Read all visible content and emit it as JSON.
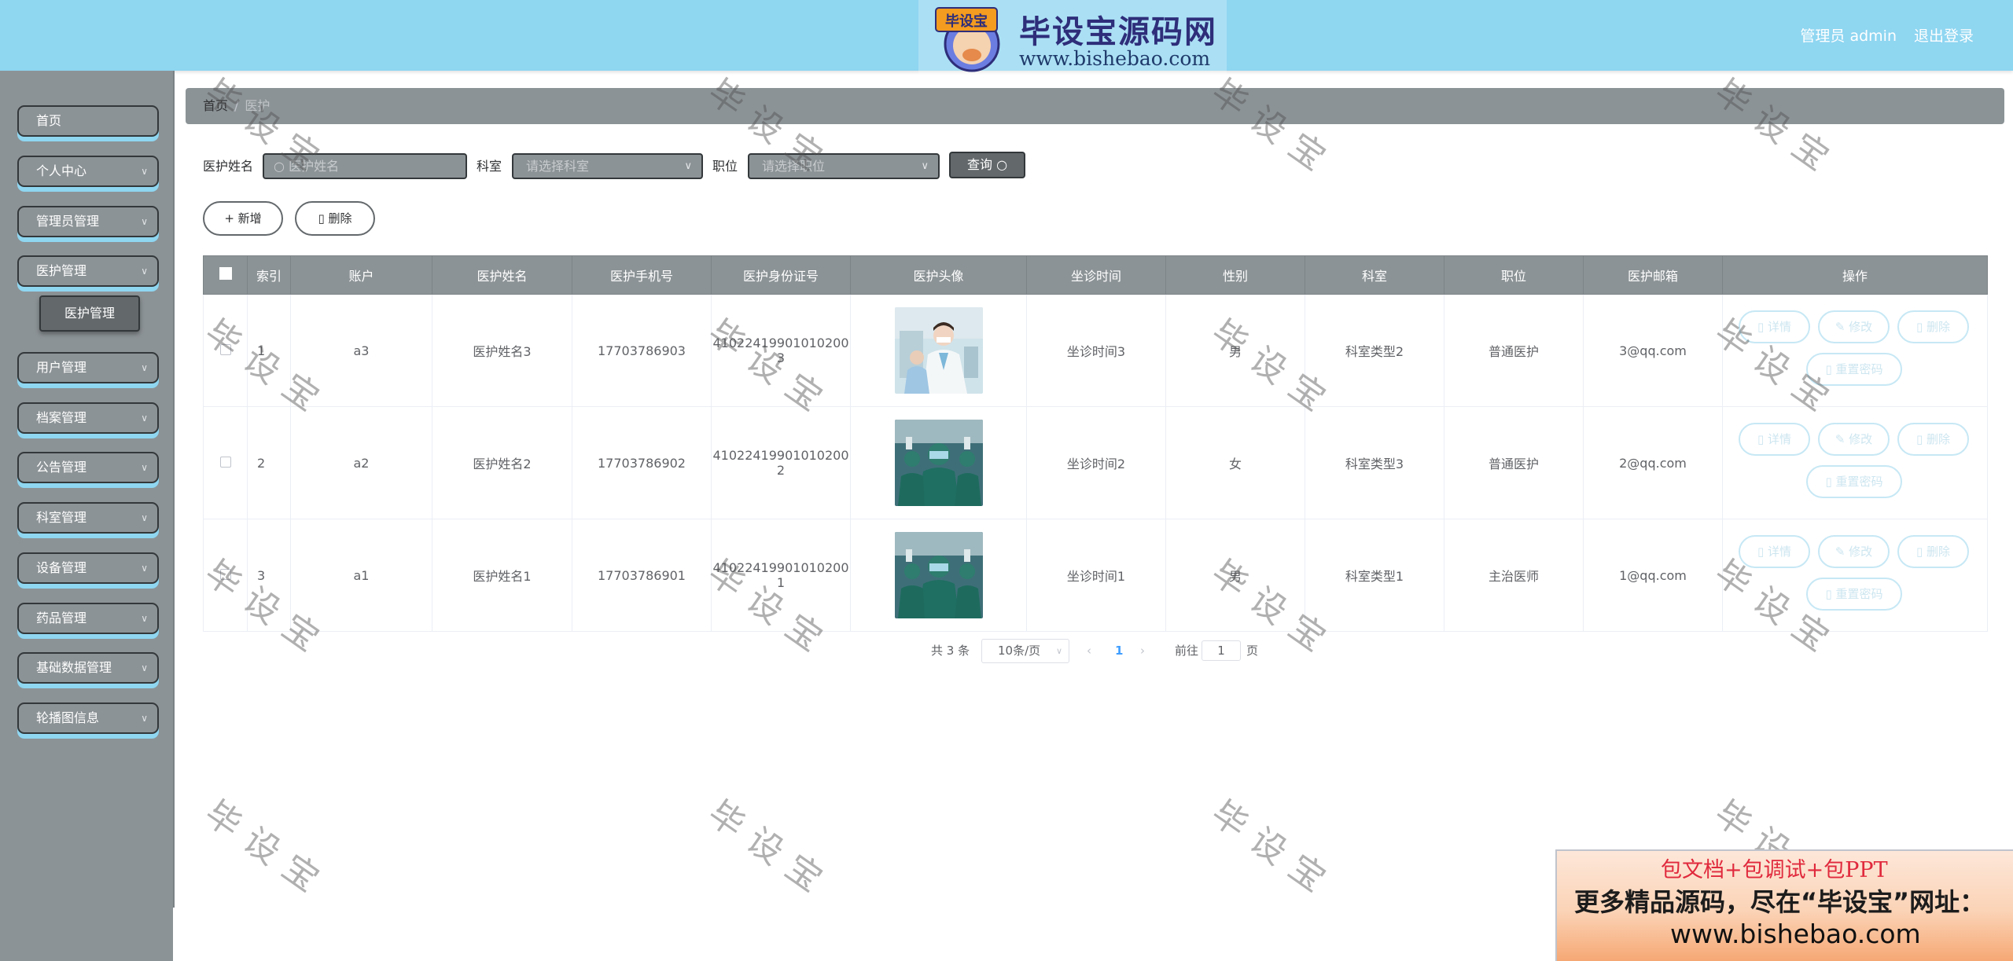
{
  "header": {
    "logo_title": "毕设宝源码网",
    "logo_url": "www.bishebao.com",
    "logo_badge": "毕设宝",
    "user": "管理员 admin",
    "logout": "退出登录"
  },
  "sidebar": {
    "items": [
      {
        "label": "首页"
      },
      {
        "label": "个人中心",
        "arrow": "∨"
      },
      {
        "label": "管理员管理",
        "arrow": "∨"
      },
      {
        "label": "医护管理",
        "arrow": "∨"
      },
      {
        "label": "用户管理",
        "arrow": "∨"
      },
      {
        "label": "档案管理",
        "arrow": "∨"
      },
      {
        "label": "公告管理",
        "arrow": "∨"
      },
      {
        "label": "科室管理",
        "arrow": "∨"
      },
      {
        "label": "设备管理",
        "arrow": "∨"
      },
      {
        "label": "药品管理",
        "arrow": "∨"
      },
      {
        "label": "基础数据管理",
        "arrow": "∨"
      },
      {
        "label": "轮播图信息",
        "arrow": "∨"
      }
    ],
    "sub_item": "医护管理"
  },
  "breadcrumb": {
    "home": "首页",
    "separator": "/",
    "current": "医护"
  },
  "search": {
    "name_label": "医护姓名",
    "name_placeholder": "医护姓名",
    "dept_label": "科室",
    "dept_placeholder": "请选择科室",
    "post_label": "职位",
    "post_placeholder": "请选择职位",
    "query_label": "查询"
  },
  "actions": {
    "add_label": "新增",
    "delete_label": "删除"
  },
  "table": {
    "columns": [
      "索引",
      "账户",
      "医护姓名",
      "医护手机号",
      "医护身份证号",
      "医护头像",
      "坐诊时间",
      "性别",
      "科室",
      "职位",
      "医护邮箱",
      "操作"
    ],
    "rows": [
      {
        "index": "1",
        "account": "a3",
        "name": "医护姓名3",
        "phone": "17703786903",
        "id_card": "410224199010102003",
        "time": "坐诊时间3",
        "gender": "男",
        "dept": "科室类型2",
        "post": "普通医护",
        "email": "3@qq.com"
      },
      {
        "index": "2",
        "account": "a2",
        "name": "医护姓名2",
        "phone": "17703786902",
        "id_card": "410224199010102002",
        "time": "坐诊时间2",
        "gender": "女",
        "dept": "科室类型3",
        "post": "普通医护",
        "email": "2@qq.com"
      },
      {
        "index": "3",
        "account": "a1",
        "name": "医护姓名1",
        "phone": "17703786901",
        "id_card": "410224199010102001",
        "time": "坐诊时间1",
        "gender": "男",
        "dept": "科室类型1",
        "post": "主治医师",
        "email": "1@qq.com"
      }
    ],
    "ops": {
      "detail": "详情",
      "edit": "修改",
      "delete": "删除",
      "reset": "重置密码"
    }
  },
  "pagination": {
    "total": "共 3 条",
    "page_size": "10条/页",
    "prev": "‹",
    "current_page": "1",
    "next": "›",
    "goto_label": "前往",
    "goto_value": "1",
    "page_unit": "页"
  },
  "watermark": "毕设宝",
  "ad": {
    "line1": "包文档+包调试+包PPT",
    "line2": "更多精品源码，尽在“毕设宝”网址：",
    "line3": "www.bishebao.com"
  },
  "colors": {
    "header_bg": "#8fd6f1",
    "sidebar_bg": "#8c9396",
    "active_bg": "#63686b",
    "accent_shadow": "#8fd6f1"
  }
}
